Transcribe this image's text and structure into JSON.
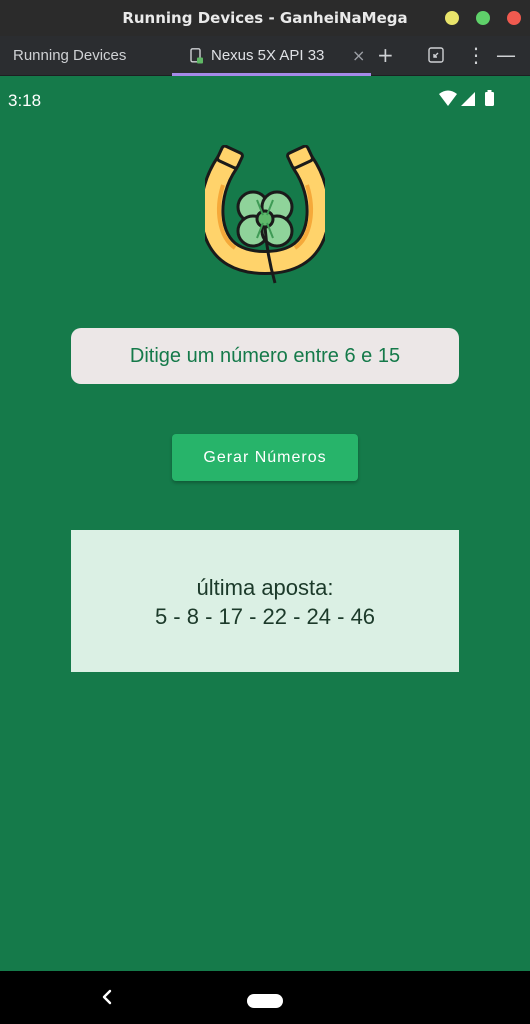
{
  "window": {
    "title": "Running Devices - GanheiNaMega"
  },
  "toolbar": {
    "tool_label": "Running Devices",
    "device_tab": "Nexus 5X API 33",
    "close_glyph": "×",
    "add_glyph": "+",
    "more_glyph": "⋮",
    "minimize_glyph": "—"
  },
  "status_bar": {
    "time": "3:18"
  },
  "app": {
    "input_placeholder": "Ditige um número entre 6 e 15",
    "button_label": "Gerar Números",
    "last_bet_label": "última aposta:",
    "last_bet_numbers": "5 - 8 - 17 - 22 - 24 - 46"
  },
  "colors": {
    "background": "#157a4a",
    "button": "#27b46a",
    "input_bg": "#ece7e7",
    "result_bg": "#dbf0e4"
  }
}
